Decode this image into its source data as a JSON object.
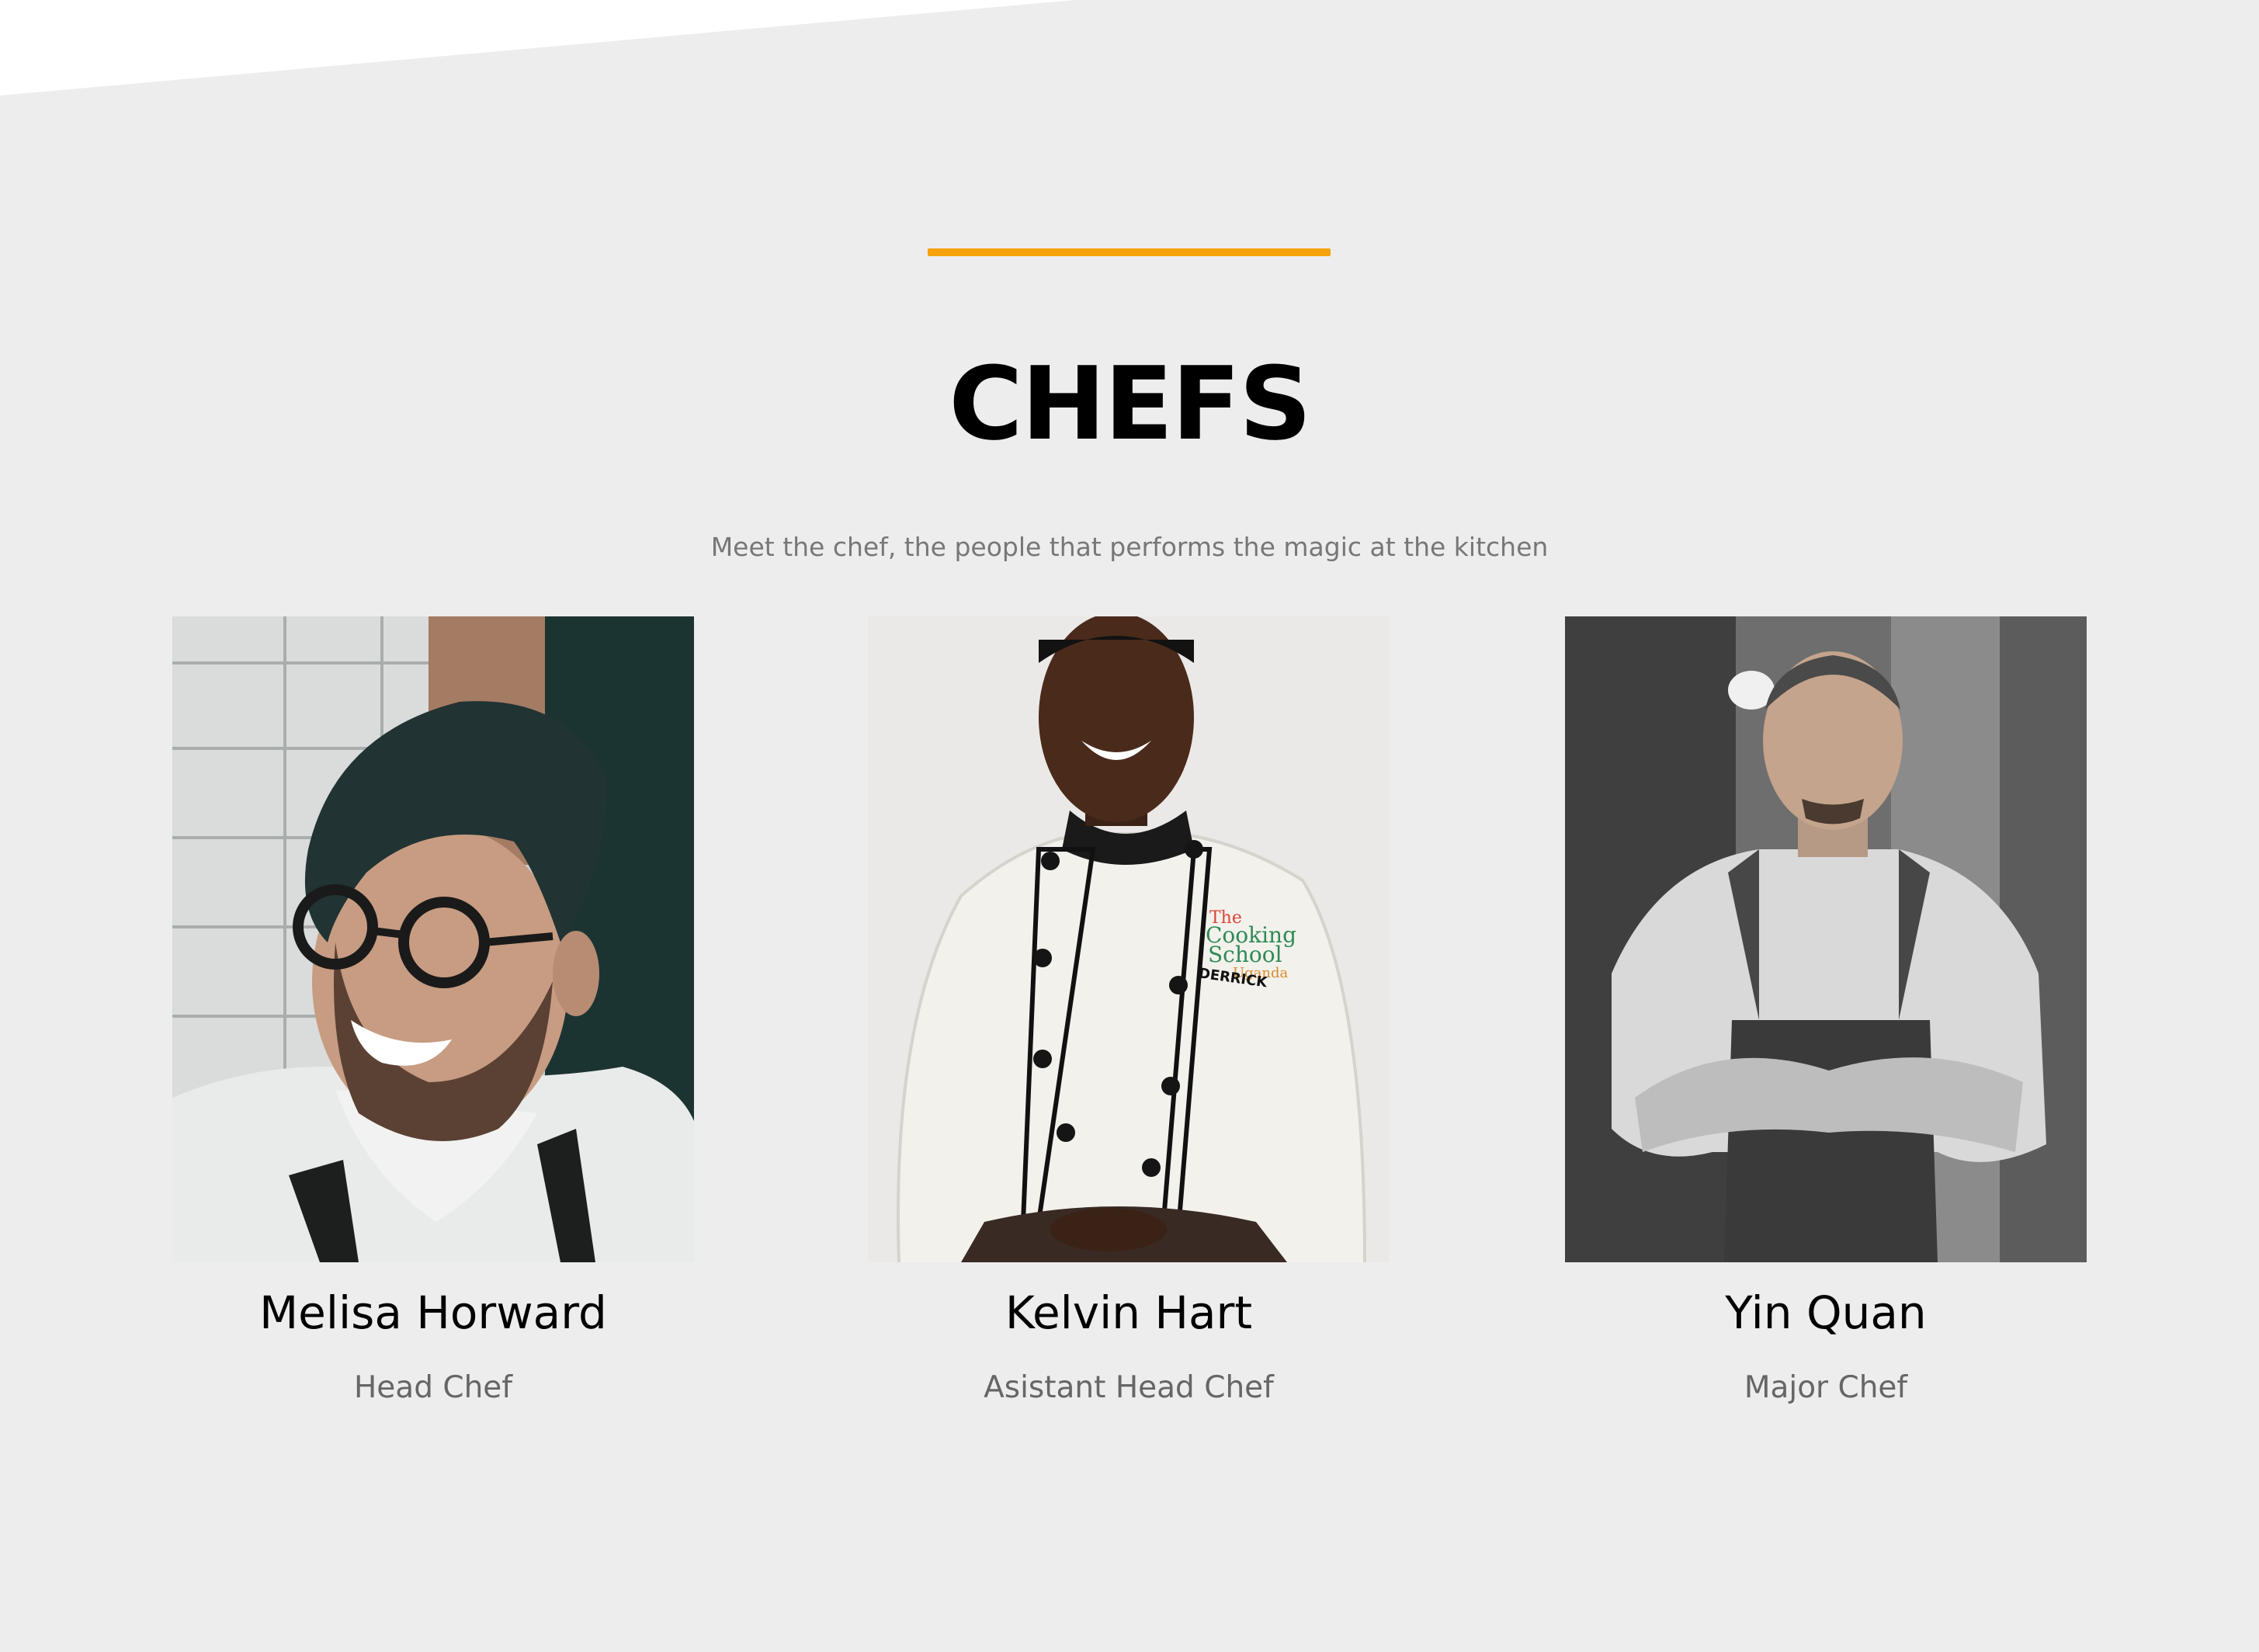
{
  "section": {
    "title": "CHEFS",
    "subtitle": "Meet the chef, the people that performs the magic at the kitchen"
  },
  "colors": {
    "background": "#ededed",
    "accent": "#f5a20c",
    "title": "#000000",
    "subtitle": "#777777"
  },
  "chefs": [
    {
      "name": "Melisa Horward",
      "role": "Head Chef",
      "photo": "smiling-chef-glasses-photo"
    },
    {
      "name": "Kelvin Hart",
      "role": "Asistant Head Chef",
      "photo": "chef-white-jacket-photo",
      "jacket_text": [
        "The",
        "Cooking",
        "School",
        "Uganda",
        "DERRICK"
      ]
    },
    {
      "name": "Yin Quan",
      "role": "Major Chef",
      "photo": "chef-arms-crossed-photo"
    }
  ]
}
